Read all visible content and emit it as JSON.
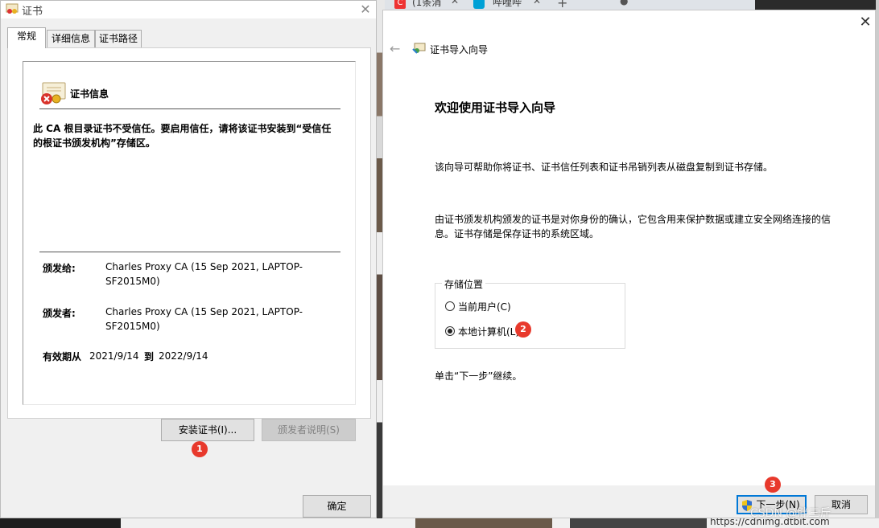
{
  "cert_dialog": {
    "title": "证书",
    "tabs": [
      "常规",
      "详细信息",
      "证书路径"
    ],
    "info_title": "证书信息",
    "warning": "此 CA 根目录证书不受信任。要启用信任，请将该证书安装到“受信任的根证书颁发机构”存储区。",
    "issued_to_label": "颁发给:",
    "issued_to_value": "Charles Proxy CA (15 Sep 2021, LAPTOP-SF2015M0)",
    "issued_by_label": "颁发者:",
    "issued_by_value": "Charles Proxy CA (15 Sep 2021, LAPTOP-SF2015M0)",
    "valid_from_label": "有效期从",
    "valid_from": "2021/9/14",
    "valid_to_label": "到",
    "valid_to": "2022/9/14",
    "install_button": "安装证书(I)...",
    "issuer_statement_button": "颁发者说明(S)",
    "ok_button": "确定"
  },
  "browser_tabs": {
    "tab1": "(1条消",
    "tab2": "哔哩哔"
  },
  "wizard": {
    "title": "证书导入向导",
    "heading": "欢迎使用证书导入向导",
    "para1": "该向导可帮助你将证书、证书信任列表和证书吊销列表从磁盘复制到证书存储。",
    "para2": "由证书颁发机构颁发的证书是对你身份的确认，它包含用来保护数据或建立安全网络连接的信息。证书存储是保存证书的系统区域。",
    "store_location_label": "存储位置",
    "option_current_user": "当前用户(C)",
    "option_local_machine": "本地计算机(L)",
    "selected": "local_machine",
    "continue_hint": "单击“下一步”继续。",
    "next_button": "下一步(N)",
    "cancel_button": "取消"
  },
  "annotations": [
    "1",
    "2",
    "3"
  ],
  "background": {
    "url_fragment": "https://cdnimg.dtbit.com"
  },
  "watermark": "CSDN @胖三斤",
  "colors": {
    "badge": "#e8392c",
    "focus_border": "#0078d7"
  }
}
